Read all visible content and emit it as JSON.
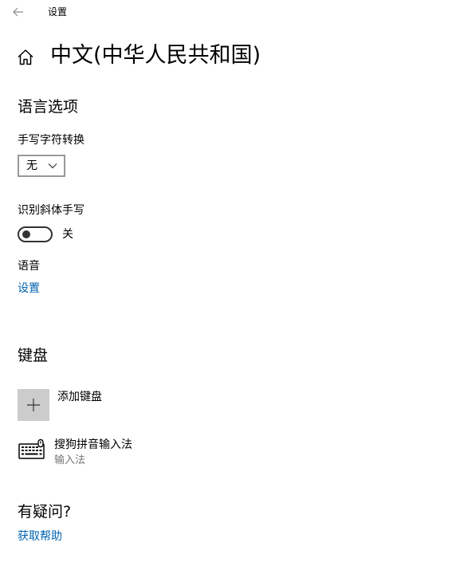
{
  "window": {
    "title": "设置"
  },
  "header": {
    "page_title": "中文(中华人民共和国)"
  },
  "language_options": {
    "section_title": "语言选项",
    "handwriting_conversion": {
      "label": "手写字符转换",
      "selected_value": "无"
    },
    "cursive_recognition": {
      "label": "识别斜体手写",
      "toggle_state": "关",
      "is_on": false
    },
    "speech": {
      "label": "语音",
      "link": "设置"
    }
  },
  "keyboard": {
    "section_title": "键盘",
    "add_keyboard_label": "添加键盘",
    "items": [
      {
        "name": "搜狗拼音输入法",
        "type": "输入法"
      }
    ]
  },
  "help": {
    "section_title": "有疑问?",
    "link": "获取帮助"
  },
  "colors": {
    "link": "#0063b1",
    "tile_gray": "#cccccc",
    "secondary_text": "#767676"
  },
  "icons": {
    "back": "back-arrow-icon",
    "home": "home-icon",
    "chevron": "chevron-down-icon",
    "plus": "plus-icon",
    "keyboard": "keyboard-icon"
  }
}
